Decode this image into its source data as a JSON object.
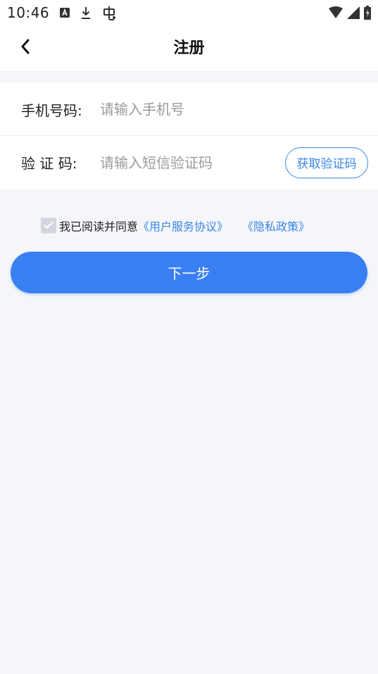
{
  "status_bar": {
    "time": "10:46",
    "icons": [
      "notification-a-icon",
      "download-icon",
      "bug-icon"
    ],
    "right_icons": [
      "wifi-icon",
      "signal-icon",
      "battery-charging-icon"
    ]
  },
  "header": {
    "back_icon": "chevron-left-icon",
    "title": "注册"
  },
  "form": {
    "phone": {
      "label": "手机号码:",
      "placeholder": "请输入手机号",
      "value": ""
    },
    "code": {
      "label": "验 证 码:",
      "placeholder": "请输入短信验证码",
      "value": "",
      "button_label": "获取验证码"
    }
  },
  "agreement": {
    "checked": true,
    "text": "我已阅读并同意",
    "user_agreement": "《用户服务协议》",
    "privacy_policy": "《隐私政策》"
  },
  "next_button": {
    "label": "下一步"
  },
  "colors": {
    "accent": "#3a7ff2",
    "link": "#3a86e6",
    "background": "#f5f6fa"
  }
}
